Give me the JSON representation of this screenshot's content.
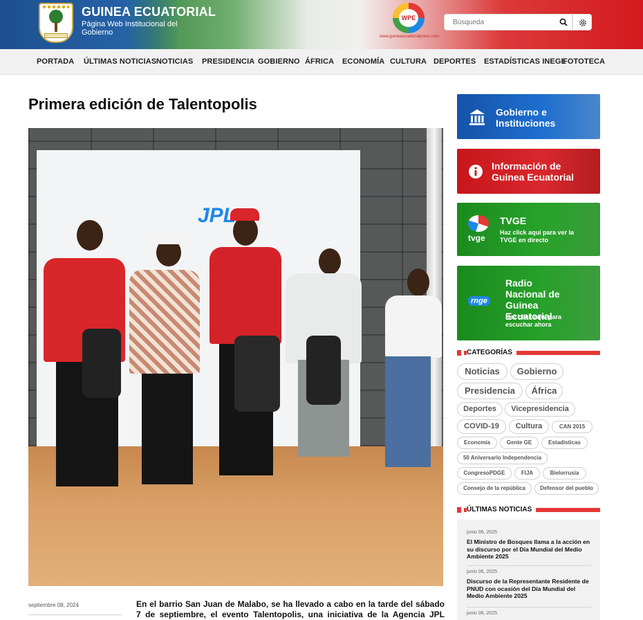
{
  "header": {
    "site_title": "GUINEA ECUATORIAL",
    "site_subtitle": "Página Web Institucional del Gobierno",
    "press_logo_text": "WPE",
    "press_url": "www.guineaecuatorialpress.com",
    "search_placeholder": "Búsqueda"
  },
  "nav": {
    "items": [
      "PORTADA",
      "ÚLTIMAS NOTICIAS",
      "NOTICIAS",
      "PRESIDENCIA",
      "GOBIERNO",
      "ÁFRICA",
      "ECONOMÍA",
      "CULTURA",
      "DEPORTES",
      "ESTADÍSTICAS INEGE",
      "FOTOTECA"
    ]
  },
  "article": {
    "title": "Primera edición de Talentopolis",
    "date": "septiembre 08, 2024",
    "lead": "En el barrio San Juan de Malabo, se ha llevado a cabo en la tarde del sábado 7 de septiembre, el evento Talentopolis, una iniciativa de la Agencia JPL (Jóvenes con",
    "photo_banner_text": "JPL"
  },
  "sidebar": {
    "promos": [
      {
        "title": "Gobierno e Instituciones",
        "subtitle": ""
      },
      {
        "title": "Información de Guinea Ecuatorial",
        "subtitle": ""
      },
      {
        "title": "TVGE",
        "subtitle": "Haz click aquí para ver la TVGE en directo",
        "logo_text": "tvge"
      },
      {
        "title": "Radio Nacional de Guinea Ecuatorial",
        "subtitle": "Haz click aquí para escuchar ahora",
        "logo_text": "rnge"
      }
    ],
    "categories_heading": "CATEGORÍAS",
    "categories": [
      "Noticias",
      "Gobierno",
      "Presidencia",
      "África",
      "Deportes",
      "Vicepresidencia",
      "COVID-19",
      "Cultura",
      "CAN 2015",
      "Economía",
      "Gente GE",
      "Estadísticas",
      "50 Aniversario Independencia",
      "CongresoPDGE",
      "FIJA",
      "Bielorrusia",
      "Consejo de la república",
      "Defensor del pueblo"
    ],
    "latest_heading": "ÚLTIMAS NOTICIAS",
    "latest": [
      {
        "date": "junio 06, 2025",
        "title": "El Ministro de Bosques llama a la acción en su discurso por el Día Mundial del Medio Ambiente 2025"
      },
      {
        "date": "junio 06, 2025",
        "title": "Discurso de la Representante Residente de PNUD con ocasión del Día Mundial del Medio Ambiente 2025"
      },
      {
        "date": "junio 06, 2025",
        "title": ""
      }
    ]
  },
  "colors": {
    "accent_red": "#e53935",
    "gov_blue": "#1553a8",
    "info_red": "#c8161b",
    "tv_green": "#1c8a1f"
  }
}
